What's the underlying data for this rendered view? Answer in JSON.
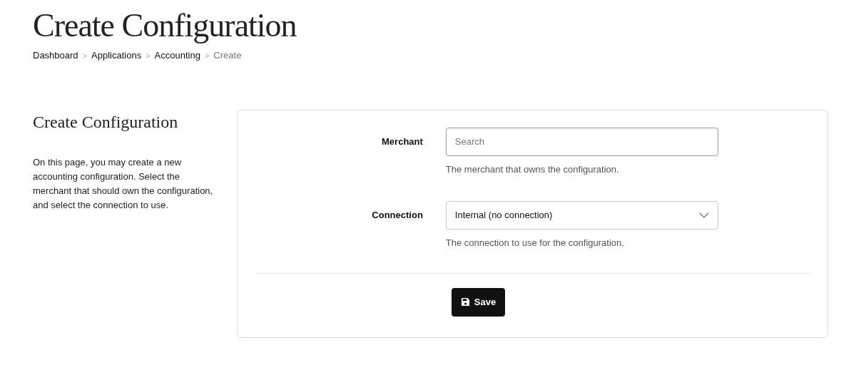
{
  "page_title": "Create Configuration",
  "breadcrumb": [
    {
      "kind": "link",
      "text": "Dashboard"
    },
    {
      "kind": "separator",
      "text": ">"
    },
    {
      "kind": "link",
      "text": "Applications"
    },
    {
      "kind": "separator",
      "text": ">"
    },
    {
      "kind": "link",
      "text": "Accounting"
    },
    {
      "kind": "separator",
      "text": ">"
    },
    {
      "kind": "current",
      "text": "Create"
    }
  ],
  "section": {
    "title": "Create Configuration",
    "description": "On this page, you may create a new accounting configuration. Select the merchant that should own the configuration, and select the connection to use."
  },
  "fields": [
    {
      "kind": "search",
      "label": "Merchant",
      "placeholder": "Search",
      "help": "The merchant that owns the configuration."
    },
    {
      "kind": "select",
      "label": "Connection",
      "value": "Internal (no connection)",
      "help": "The connection to use for the configuration."
    }
  ],
  "save_button": "Save"
}
